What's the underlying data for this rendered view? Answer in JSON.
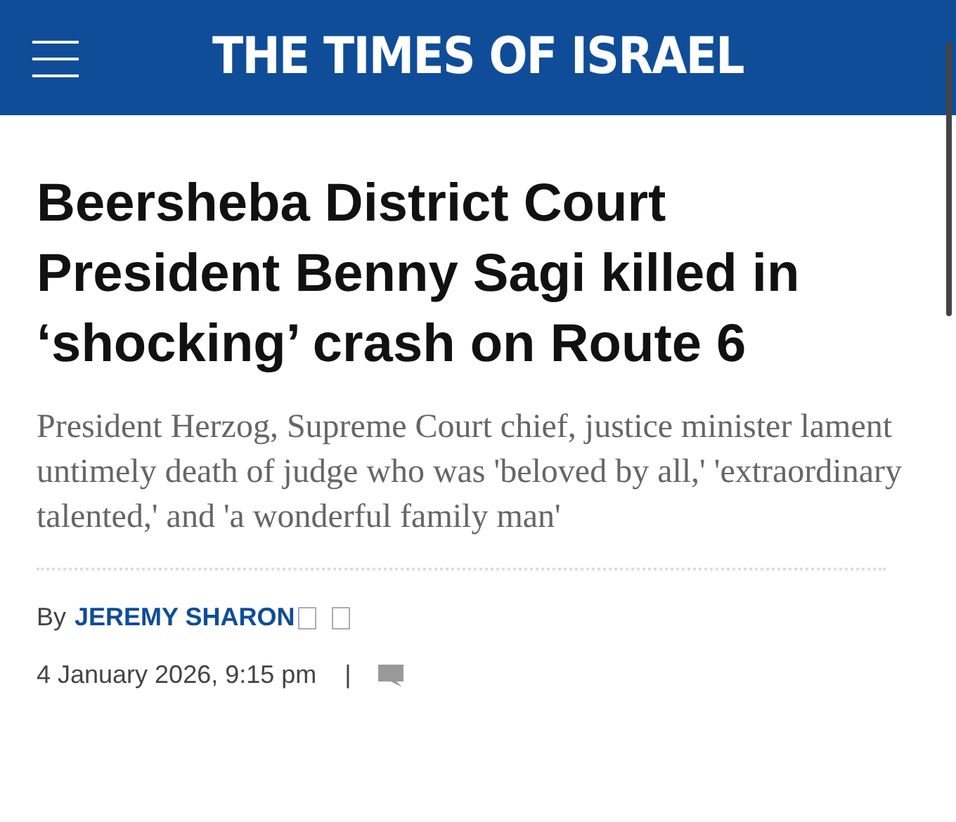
{
  "header": {
    "logo": "THE TIMES OF ISRAEL"
  },
  "article": {
    "headline": "Beersheba District Court President Benny Sagi killed in ‘shocking’ crash on Route 6",
    "subheadline": "President Herzog, Supreme Court chief, justice minister lament untimely death of judge who was 'beloved by all,' 'extraordinary talented,' and 'a wonderful family man'",
    "byline": {
      "prefix": "By",
      "author": "JEREMY SHARON"
    },
    "date": "4 January 2026, 9:15 pm",
    "separator": "|"
  }
}
